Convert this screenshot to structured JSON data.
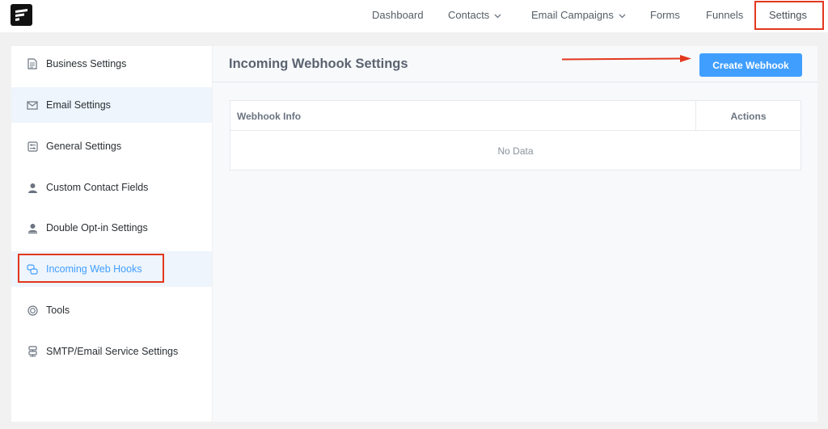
{
  "nav": {
    "items": [
      {
        "label": "Dashboard"
      },
      {
        "label": "Contacts"
      },
      {
        "label": "Email Campaigns"
      },
      {
        "label": "Forms"
      },
      {
        "label": "Funnels"
      },
      {
        "label": "Settings"
      }
    ]
  },
  "sidebar": {
    "items": [
      {
        "label": "Business Settings",
        "icon": "document-icon"
      },
      {
        "label": "Email Settings",
        "icon": "envelope-icon"
      },
      {
        "label": "General Settings",
        "icon": "settings-card-icon"
      },
      {
        "label": "Custom Contact Fields",
        "icon": "user-icon"
      },
      {
        "label": "Double Opt-in Settings",
        "icon": "user-check-icon"
      },
      {
        "label": "Incoming Web Hooks",
        "icon": "webhook-icon"
      },
      {
        "label": "Tools",
        "icon": "tools-icon"
      },
      {
        "label": "SMTP/Email Service Settings",
        "icon": "server-icon"
      }
    ]
  },
  "main": {
    "title": "Incoming Webhook Settings",
    "create_button": "Create Webhook",
    "table": {
      "columns": [
        "Webhook Info",
        "Actions"
      ],
      "empty_text": "No Data"
    }
  },
  "colors": {
    "accent": "#409eff",
    "highlight": "#e3371e"
  }
}
